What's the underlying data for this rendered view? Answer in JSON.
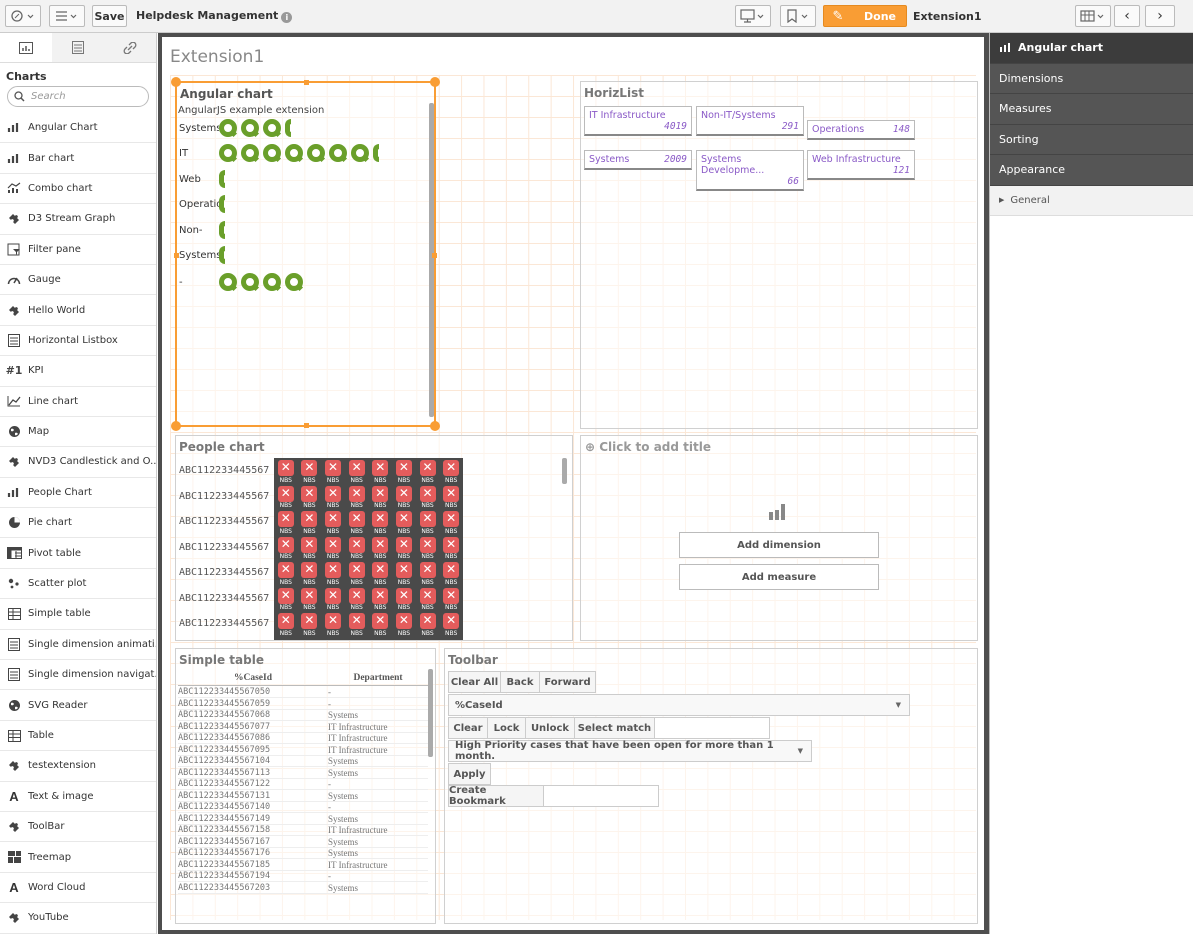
{
  "toolbar": {
    "save_label": "Save",
    "app_title": "Helpdesk Management",
    "done_label": "Done",
    "sheet_name": "Extension1"
  },
  "left_panel": {
    "heading": "Charts",
    "search_placeholder": "Search",
    "items": [
      {
        "label": "Angular Chart",
        "icon": "bar-chart-icon"
      },
      {
        "label": "Bar chart",
        "icon": "bar-chart-icon"
      },
      {
        "label": "Combo chart",
        "icon": "combo-chart-icon"
      },
      {
        "label": "D3 Stream Graph",
        "icon": "puzzle-icon"
      },
      {
        "label": "Filter pane",
        "icon": "filter-pane-icon"
      },
      {
        "label": "Gauge",
        "icon": "gauge-icon"
      },
      {
        "label": "Hello World",
        "icon": "puzzle-icon"
      },
      {
        "label": "Horizontal Listbox",
        "icon": "list-icon"
      },
      {
        "label": "KPI",
        "icon": "kpi-icon"
      },
      {
        "label": "Line chart",
        "icon": "line-chart-icon"
      },
      {
        "label": "Map",
        "icon": "globe-icon"
      },
      {
        "label": "NVD3 Candlestick and O...",
        "icon": "puzzle-icon"
      },
      {
        "label": "People Chart",
        "icon": "bar-chart-icon"
      },
      {
        "label": "Pie chart",
        "icon": "pie-chart-icon"
      },
      {
        "label": "Pivot table",
        "icon": "pivot-table-icon"
      },
      {
        "label": "Scatter plot",
        "icon": "scatter-plot-icon"
      },
      {
        "label": "Simple table",
        "icon": "table-icon"
      },
      {
        "label": "Single dimension animati...",
        "icon": "list-icon"
      },
      {
        "label": "Single dimension navigat...",
        "icon": "list-icon"
      },
      {
        "label": "SVG Reader",
        "icon": "globe-icon"
      },
      {
        "label": "Table",
        "icon": "table-icon"
      },
      {
        "label": "testextension",
        "icon": "puzzle-icon"
      },
      {
        "label": "Text & image",
        "icon": "text-icon"
      },
      {
        "label": "ToolBar",
        "icon": "puzzle-icon"
      },
      {
        "label": "Treemap",
        "icon": "treemap-icon"
      },
      {
        "label": "Word Cloud",
        "icon": "text-icon"
      },
      {
        "label": "YouTube",
        "icon": "puzzle-icon"
      }
    ]
  },
  "sheet": {
    "title": "Extension1"
  },
  "angular_chart": {
    "title": "Angular chart",
    "subtitle": "AngularJS example extension",
    "rows": [
      {
        "label": "Systems",
        "full_rings": 3,
        "partial": true
      },
      {
        "label": "IT",
        "full_rings": 7,
        "partial": true
      },
      {
        "label": "Web",
        "full_rings": 0,
        "partial": true
      },
      {
        "label": "Operatio",
        "full_rings": 0,
        "partial": true
      },
      {
        "label": "Non-",
        "full_rings": 0,
        "partial": true
      },
      {
        "label": "Systems",
        "full_rings": 0,
        "partial": true
      },
      {
        "label": "-",
        "full_rings": 4,
        "partial": false
      }
    ]
  },
  "horiz_list": {
    "title": "HorizList",
    "cells": [
      {
        "label": "IT Infrastructure",
        "value": "4019"
      },
      {
        "label": "Non-IT/Systems",
        "value": "291"
      },
      {
        "label": "Operations",
        "value": "148"
      },
      {
        "label": "Systems",
        "value": "2009"
      },
      {
        "label": "Systems Developme...",
        "value": "66"
      },
      {
        "label": "Web Infrastructure",
        "value": "121"
      }
    ]
  },
  "people_chart": {
    "title": "People chart",
    "row_labels": [
      "ABC112233445567",
      "ABC112233445567",
      "ABC112233445567",
      "ABC112233445567",
      "ABC112233445567",
      "ABC112233445567",
      "ABC112233445567"
    ],
    "cell_text": "NBS"
  },
  "add_chart": {
    "title": "Click to add title",
    "add_dimension": "Add dimension",
    "add_measure": "Add measure"
  },
  "simple_table": {
    "title": "Simple table",
    "columns": [
      "%CaseId",
      "Department"
    ],
    "rows": [
      [
        "ABC112233445567050",
        "-"
      ],
      [
        "ABC112233445567059",
        "-"
      ],
      [
        "ABC112233445567068",
        "Systems"
      ],
      [
        "ABC112233445567077",
        "IT Infrastructure"
      ],
      [
        "ABC112233445567086",
        "IT Infrastructure"
      ],
      [
        "ABC112233445567095",
        "IT Infrastructure"
      ],
      [
        "ABC112233445567104",
        "Systems"
      ],
      [
        "ABC112233445567113",
        "Systems"
      ],
      [
        "ABC112233445567122",
        "-"
      ],
      [
        "ABC112233445567131",
        "Systems"
      ],
      [
        "ABC112233445567140",
        "-"
      ],
      [
        "ABC112233445567149",
        "Systems"
      ],
      [
        "ABC112233445567158",
        "IT Infrastructure"
      ],
      [
        "ABC112233445567167",
        "Systems"
      ],
      [
        "ABC112233445567176",
        "Systems"
      ],
      [
        "ABC112233445567185",
        "IT Infrastructure"
      ],
      [
        "ABC112233445567194",
        "-"
      ],
      [
        "ABC112233445567203",
        "Systems"
      ]
    ]
  },
  "toolbar_ext": {
    "title": "Toolbar",
    "clear_all": "Clear All",
    "back": "Back",
    "forward": "Forward",
    "field_select": "%CaseId",
    "clear": "Clear",
    "lock": "Lock",
    "unlock": "Unlock",
    "select_match": "Select match",
    "bookmark_select": "High Priority cases that have been open for more than 1 month.",
    "apply": "Apply",
    "create_bookmark": "Create Bookmark"
  },
  "right_panel": {
    "header": "Angular chart",
    "sections": [
      "Dimensions",
      "Measures",
      "Sorting",
      "Appearance"
    ],
    "general": "General"
  }
}
